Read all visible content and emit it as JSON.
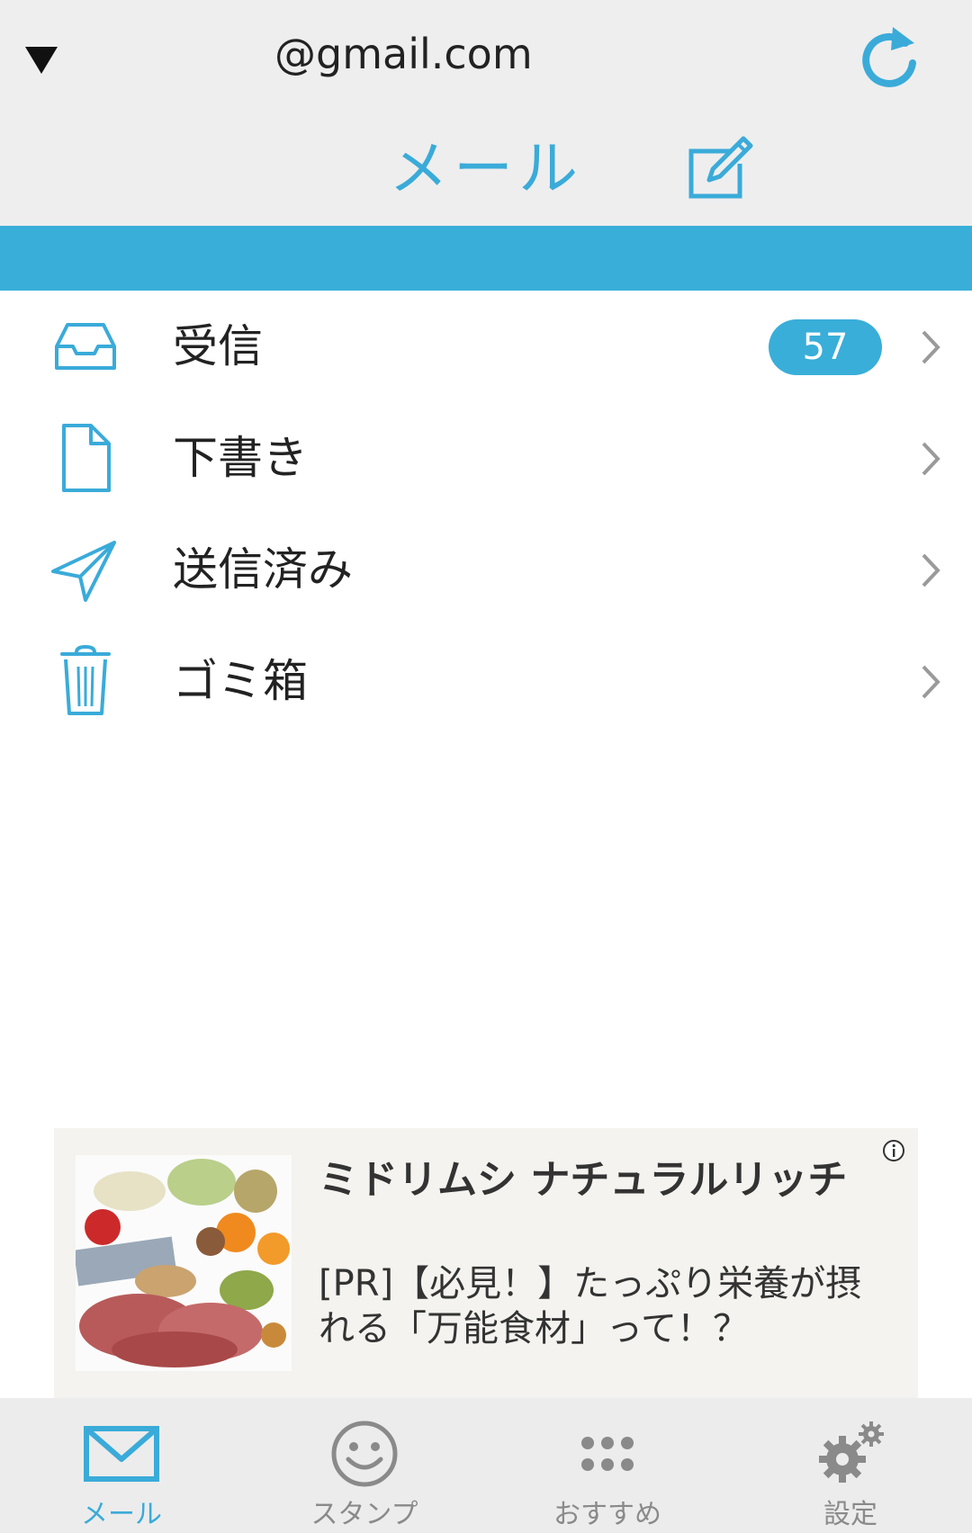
{
  "header": {
    "account_email": "@gmail.com",
    "title": "メール",
    "toggle_icon": "triangle-down-icon",
    "refresh_icon": "refresh-icon",
    "compose_icon": "compose-icon"
  },
  "folders": [
    {
      "label": "受信",
      "icon": "inbox-icon",
      "badge": "57"
    },
    {
      "label": "下書き",
      "icon": "draft-icon",
      "badge": null
    },
    {
      "label": "送信済み",
      "icon": "sent-icon",
      "badge": null
    },
    {
      "label": "ゴミ箱",
      "icon": "trash-icon",
      "badge": null
    }
  ],
  "ad": {
    "title": "ミドリムシ ナチュラルリッチ",
    "description": "[PR]【必見！】たっぷり栄養が摂れる「万能食材」って！？",
    "info_icon": "info-icon"
  },
  "bottom_nav": [
    {
      "label": "メール",
      "icon": "mail-icon",
      "active": true
    },
    {
      "label": "スタンプ",
      "icon": "smiley-icon",
      "active": false
    },
    {
      "label": "おすすめ",
      "icon": "grid-dots-icon",
      "active": false
    },
    {
      "label": "設定",
      "icon": "gear-icon",
      "active": false
    }
  ],
  "colors": {
    "accent": "#39aed9",
    "header_bg": "#eeeeee",
    "nav_bg": "#ececec",
    "nav_inactive": "#8a8a8a"
  }
}
